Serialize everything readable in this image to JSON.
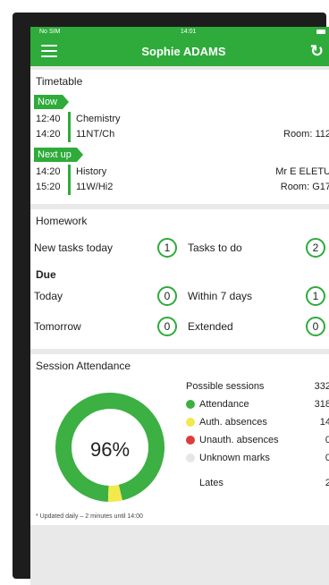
{
  "status": {
    "carrier": "No SIM",
    "time": "14:01"
  },
  "header": {
    "title": "Sophie ADAMS"
  },
  "timetable": {
    "title": "Timetable",
    "now_label": "Now",
    "next_label": "Next up",
    "now": {
      "start": "12:40",
      "end": "14:20",
      "subject": "Chemistry",
      "group": "11NT/Ch",
      "teacher": "",
      "room": "Room: 112"
    },
    "next": {
      "start": "14:20",
      "end": "15:20",
      "subject": "History",
      "group": "11W/Hi2",
      "teacher": "Mr E ELETU",
      "room": "Room: G17"
    }
  },
  "homework": {
    "title": "Homework",
    "new_tasks_label": "New tasks today",
    "new_tasks": "1",
    "tasks_to_do_label": "Tasks to do",
    "tasks_to_do": "2",
    "due_label": "Due",
    "today_label": "Today",
    "today": "0",
    "within7_label": "Within 7 days",
    "within7": "1",
    "tomorrow_label": "Tomorrow",
    "tomorrow": "0",
    "extended_label": "Extended",
    "extended": "0"
  },
  "attendance": {
    "title": "Session Attendance",
    "percent_text": "96%",
    "possible_label": "Possible sessions",
    "possible": "332",
    "attendance_label": "Attendance",
    "attendance": "318",
    "auth_label": "Auth. absences",
    "auth": "14",
    "unauth_label": "Unauth. absences",
    "unauth": "0",
    "unknown_label": "Unknown marks",
    "unknown": "0",
    "lates_label": "Lates",
    "lates": "2",
    "footnote": "* Updated daily – 2 minutes until 14:00",
    "colors": {
      "attendance": "#3cb043",
      "auth": "#f3e84c",
      "unauth": "#e03b3b",
      "unknown": "#e6e6e6"
    }
  },
  "chart_data": {
    "type": "pie",
    "categories": [
      "Attendance",
      "Auth. absences",
      "Unauth. absences",
      "Unknown marks"
    ],
    "values": [
      318,
      14,
      0,
      0
    ]
  }
}
